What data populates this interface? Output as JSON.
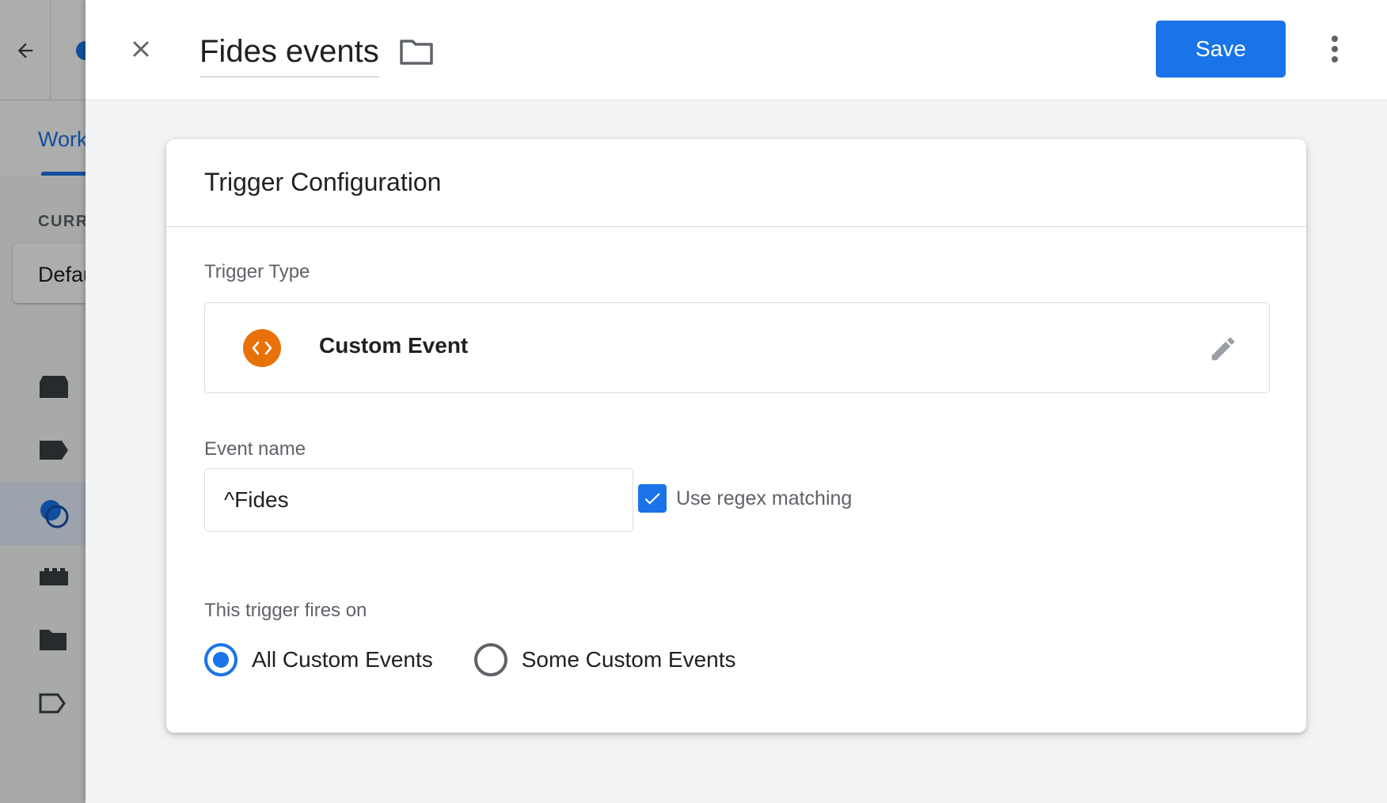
{
  "background": {
    "tab_label": "Workspace",
    "section_label": "CURRENT WORKSPACE",
    "workspace_name": "Default Workspace",
    "nav_icons": [
      "overview-icon",
      "tags-icon",
      "triggers-icon",
      "variables-icon",
      "folders-icon",
      "templates-icon"
    ]
  },
  "header": {
    "title": "Fides events",
    "save_label": "Save"
  },
  "card": {
    "title": "Trigger Configuration",
    "trigger_type_label": "Trigger Type",
    "trigger_type_name": "Custom Event",
    "event_name_label": "Event name",
    "event_name_value": "^Fides",
    "regex_label": "Use regex matching",
    "regex_checked": true,
    "fires_on_label": "This trigger fires on",
    "fires_on_options": [
      "All Custom Events",
      "Some Custom Events"
    ],
    "fires_on_selected": "All Custom Events"
  },
  "colors": {
    "accent": "#1a73e8",
    "custom_event_icon": "#e8710a"
  }
}
